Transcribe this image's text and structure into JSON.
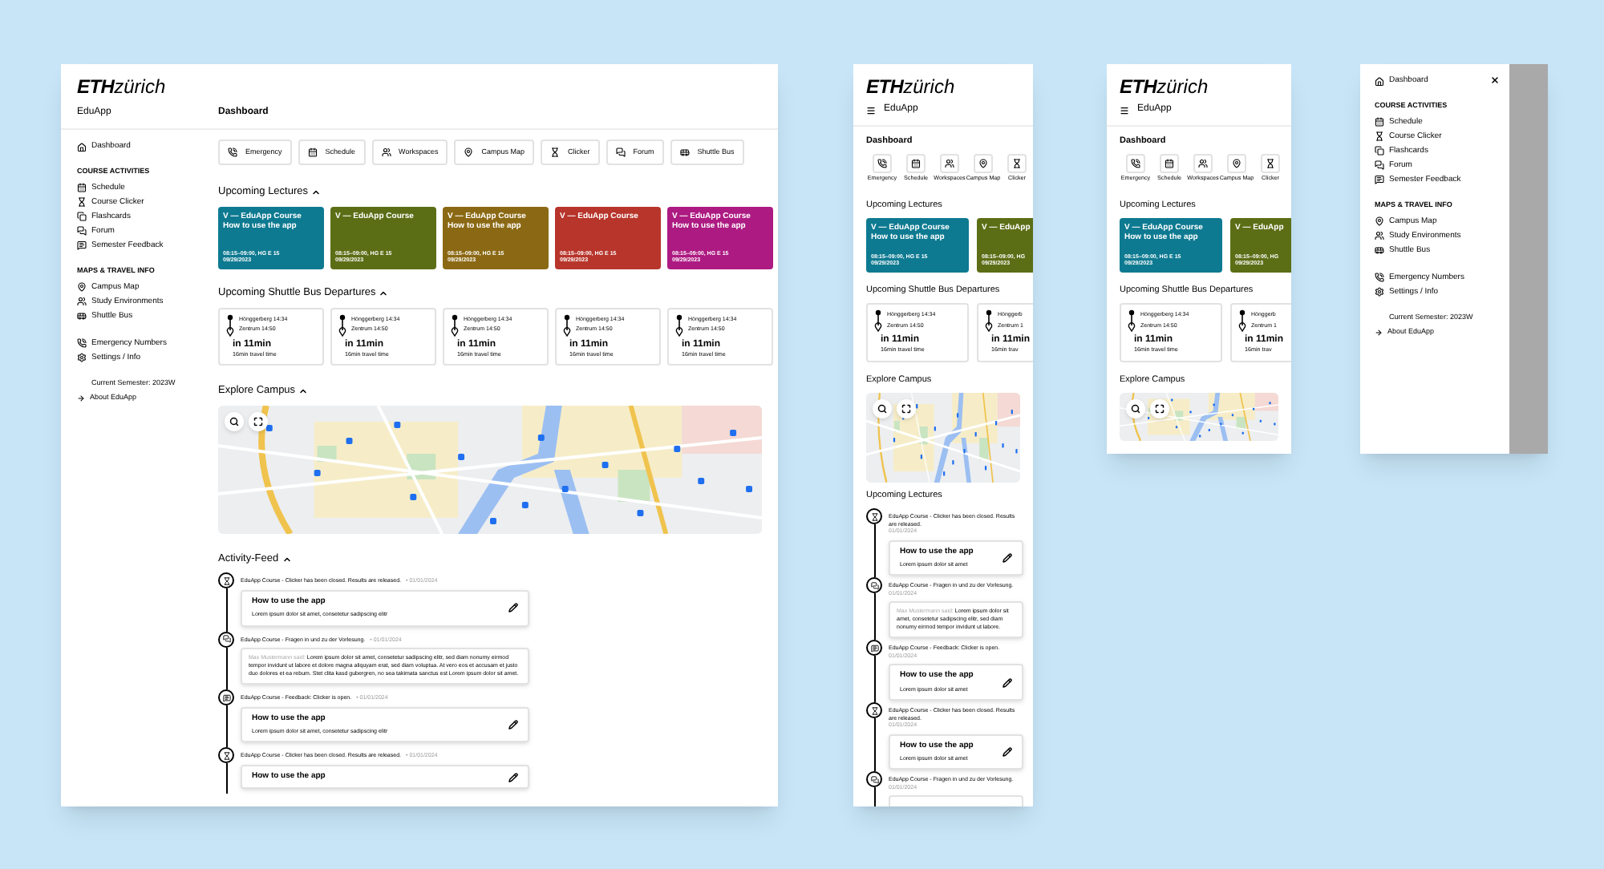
{
  "desktop": {
    "logo": {
      "mark": "ETH",
      "word": "zürich"
    },
    "app_name": "EduApp",
    "page_title": "Dashboard",
    "sidebar": {
      "top": [
        {
          "kind": "dashboard",
          "label": "Dashboard"
        }
      ],
      "sections": [
        {
          "heading": "COURSE ACTIVITIES",
          "items": [
            {
              "kind": "schedule",
              "label": "Schedule"
            },
            {
              "kind": "clicker",
              "label": "Course Clicker"
            },
            {
              "kind": "flashcards",
              "label": "Flashcards"
            },
            {
              "kind": "forum",
              "label": "Forum"
            },
            {
              "kind": "feedback",
              "label": "Semester Feedback"
            }
          ]
        },
        {
          "heading": "MAPS & TRAVEL INFO",
          "items": [
            {
              "kind": "campus_map",
              "label": "Campus Map"
            },
            {
              "kind": "study",
              "label": "Study Environments"
            },
            {
              "kind": "shuttle",
              "label": "Shuttle Bus"
            }
          ]
        }
      ],
      "extra": [
        {
          "kind": "emergency",
          "label": "Emergency Numbers"
        },
        {
          "kind": "settings",
          "label": "Settings / Info"
        }
      ],
      "semester": "Current Semester: 2023W",
      "about": "About EduApp"
    },
    "shortcuts": [
      {
        "kind": "emergency",
        "label": "Emergency"
      },
      {
        "kind": "schedule",
        "label": "Schedule"
      },
      {
        "kind": "study",
        "label": "Workspaces"
      },
      {
        "kind": "campus_map",
        "label": "Campus Map"
      },
      {
        "kind": "clicker",
        "label": "Clicker"
      },
      {
        "kind": "forum",
        "label": "Forum"
      },
      {
        "kind": "shuttle",
        "label": "Shuttle Bus"
      }
    ],
    "lectures": {
      "title": "Upcoming Lectures",
      "expanded": true,
      "cards": [
        {
          "color": "#0e7a91",
          "lines": [
            "V — EduApp Course",
            "How to use the app"
          ],
          "time": "08:15–09:00, HG E 15",
          "date": "09/29/2023"
        },
        {
          "color": "#5b6e16",
          "lines": [
            "V — EduApp Course"
          ],
          "time": "08:15–09:00, HG E 15",
          "date": "09/29/2023"
        },
        {
          "color": "#8b6914",
          "lines": [
            "V — EduApp Course",
            "How to use the app"
          ],
          "time": "08:15–09:00, HG E 15",
          "date": "09/29/2023"
        },
        {
          "color": "#b7352b",
          "lines": [
            "V — EduApp Course"
          ],
          "time": "08:15–09:00, HG E 15",
          "date": "09/29/2023"
        },
        {
          "color": "#ad1a82",
          "lines": [
            "V — EduApp Course",
            "How to use the app"
          ],
          "time": "08:15–09:00, HG E 15",
          "date": "09/29/2023"
        }
      ]
    },
    "shuttle": {
      "title": "Upcoming Shuttle Bus Departures",
      "expanded": true,
      "cards": [
        {
          "from": "Hönggerberg 14:34",
          "to": "Zentrum 14:50",
          "eta": "in 11min",
          "note": "16min travel time"
        },
        {
          "from": "Hönggerberg 14:34",
          "to": "Zentrum 14:50",
          "eta": "in 11min",
          "note": "16min travel time"
        },
        {
          "from": "Hönggerberg 14:34",
          "to": "Zentrum 14:50",
          "eta": "in 11min",
          "note": "16min travel time"
        },
        {
          "from": "Hönggerberg 14:34",
          "to": "Zentrum 14:50",
          "eta": "in 11min",
          "note": "16min travel time"
        },
        {
          "from": "Hönggerberg 14:34",
          "to": "Zentrum 14:50",
          "eta": "in 11min",
          "note": "16min travel time"
        }
      ]
    },
    "explore": {
      "title": "Explore Campus",
      "expanded": true
    },
    "feed": {
      "title": "Activity-Feed",
      "expanded": true,
      "items": [
        {
          "kind": "clicker",
          "meta": "EduApp Course - Clicker has been closed. Results are released.",
          "date": "• 01/01/2024",
          "title": "How to use the app",
          "body": "Lorem ipsum dolor sit amet, consetetur sadipscing elitr"
        },
        {
          "kind": "forum",
          "meta": "EduApp Course - Fragen in und zu der Vorlesung.",
          "date": "• 01/01/2024",
          "author": "Max Mustermann said:",
          "text": "Lorem ipsum dolor sit amet, consetetur sadipscing elitr, sed diam nonumy eirmod tempor invidunt ut labore et dolore magna aliquyam erat, sed diam voluptua. At vero eos et accusam et justo duo dolores et ea rebum. Stet clita kasd gubergren, no sea takimata sanctus est Lorem ipsum dolor sit amet."
        },
        {
          "kind": "feedback",
          "meta": "EduApp Course - Feedback: Clicker is open.",
          "date": "• 01/01/2024",
          "title": "How to use the app",
          "body": "Lorem ipsum dolor sit amet, consetetur sadipscing elitr"
        },
        {
          "kind": "clicker",
          "meta": "EduApp Course - Clicker has been closed. Results are released.",
          "date": "• 01/01/2024",
          "title": "How to use the app"
        }
      ]
    }
  },
  "mobile_long": {
    "logo": {
      "mark": "ETH",
      "word": "zürich"
    },
    "app_name": "EduApp",
    "page_title": "Dashboard",
    "shortcuts": [
      {
        "kind": "emergency",
        "label": "Emergency"
      },
      {
        "kind": "schedule",
        "label": "Schedule"
      },
      {
        "kind": "study",
        "label": "Workspaces"
      },
      {
        "kind": "campus_map",
        "label": "Campus Map"
      },
      {
        "kind": "clicker",
        "label": "Clicker"
      }
    ],
    "lectures_title": "Upcoming Lectures",
    "lectures": [
      {
        "color": "#0e7a91",
        "lines": [
          "V — EduApp Course",
          "How to use the app"
        ],
        "time": "08:15–09:00, HG E 15",
        "date": "09/29/2023"
      },
      {
        "color": "#5b6e16",
        "lines": [
          "V — EduApp"
        ],
        "time": "08:15–09:00, HG",
        "date": "09/29/2023"
      }
    ],
    "shuttle_title": "Upcoming Shuttle Bus Departures",
    "shuttle": [
      {
        "from": "Hönggerberg 14:34",
        "to": "Zentrum 14:50",
        "eta": "in 11min",
        "note": "16min travel time"
      },
      {
        "from": "Hönggerb",
        "to": "Zentrum 1",
        "eta": "in 11min",
        "note": "16min trav"
      }
    ],
    "explore_title": "Explore Campus",
    "feed_title": "Upcoming Lectures",
    "feed": [
      {
        "kind": "clicker",
        "meta": "EduApp Course - Clicker has been closed. Results are released.",
        "date": "01/01/2024",
        "title": "How to use the app",
        "body": "Lorem ipsum dolor sit amet"
      },
      {
        "kind": "forum",
        "meta": "EduApp Course - Fragen in und zu der Vorlesung.",
        "date": "01/01/2024",
        "author": "Max Mustermann said:",
        "text": "Lorem ipsum dolor sit amet, consetetur sadipscing elitr, sed diam nonumy eirmod tempor invidunt ut labore."
      },
      {
        "kind": "feedback",
        "meta": "EduApp Course - Feedback: Clicker is open.",
        "date": "01/01/2024",
        "title": "How to use the app",
        "body": "Lorem ipsum dolor sit amet"
      },
      {
        "kind": "clicker",
        "meta": "EduApp Course - Clicker has been closed. Results are released.",
        "date": "01/01/2024",
        "title": "How to use the app",
        "body": "Lorem ipsum dolor sit amet"
      },
      {
        "kind": "forum",
        "meta": "EduApp Course - Fragen in und zu der Vorlesung.",
        "date": "01/01/2024"
      }
    ]
  },
  "mobile_short": {
    "logo": {
      "mark": "ETH",
      "word": "zürich"
    },
    "app_name": "EduApp",
    "page_title": "Dashboard",
    "shortcuts": [
      {
        "kind": "emergency",
        "label": "Emergency"
      },
      {
        "kind": "schedule",
        "label": "Schedule"
      },
      {
        "kind": "study",
        "label": "Workspaces"
      },
      {
        "kind": "campus_map",
        "label": "Campus Map"
      },
      {
        "kind": "clicker",
        "label": "Clicker"
      }
    ],
    "lectures_title": "Upcoming Lectures",
    "lectures": [
      {
        "color": "#0e7a91",
        "lines": [
          "V — EduApp Course",
          "How to use the app"
        ],
        "time": "08:15–09:00, HG E 15",
        "date": "09/29/2023"
      },
      {
        "color": "#5b6e16",
        "lines": [
          "V — EduApp"
        ],
        "time": "08:15–09:00, HG",
        "date": "09/29/2023"
      }
    ],
    "shuttle_title": "Upcoming Shuttle Bus Departures",
    "shuttle": [
      {
        "from": "Hönggerberg 14:34",
        "to": "Zentrum 14:50",
        "eta": "in 11min",
        "note": "16min travel time"
      },
      {
        "from": "Hönggerb",
        "to": "Zentrum 1",
        "eta": "in 11min",
        "note": "16min trav"
      }
    ],
    "explore_title": "Explore Campus"
  },
  "menu": {
    "top": [
      {
        "kind": "dashboard",
        "label": "Dashboard"
      }
    ],
    "sections": [
      {
        "heading": "COURSE ACTIVITIES",
        "items": [
          {
            "kind": "schedule",
            "label": "Schedule"
          },
          {
            "kind": "clicker",
            "label": "Course Clicker"
          },
          {
            "kind": "flashcards",
            "label": "Flashcards"
          },
          {
            "kind": "forum",
            "label": "Forum"
          },
          {
            "kind": "feedback",
            "label": "Semester Feedback"
          }
        ]
      },
      {
        "heading": "MAPS & TRAVEL INFO",
        "items": [
          {
            "kind": "campus_map",
            "label": "Campus Map"
          },
          {
            "kind": "study",
            "label": "Study Environments"
          },
          {
            "kind": "shuttle",
            "label": "Shuttle Bus"
          }
        ]
      }
    ],
    "extra": [
      {
        "kind": "emergency",
        "label": "Emergency Numbers"
      },
      {
        "kind": "settings",
        "label": "Settings / Info"
      }
    ],
    "semester": "Current Semester: 2023W",
    "about": "About EduApp"
  }
}
